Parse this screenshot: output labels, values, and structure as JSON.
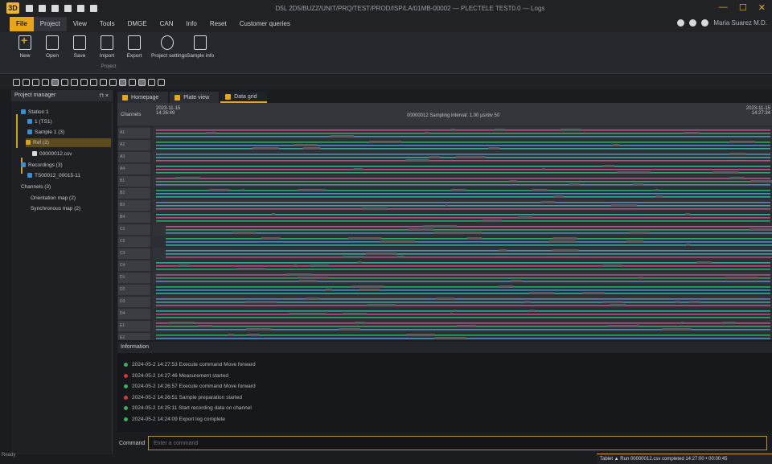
{
  "window": {
    "title": "D5L 2D5/BUZZ/UNIT/PRQ/TEST/PROD/ISP/LA/01MB-00002 — PLECTELE TEST0.0 — Logs",
    "app_logo": "3D",
    "controls": [
      "—",
      "☐",
      "✕"
    ]
  },
  "menu": {
    "items": [
      "File",
      "Project",
      "View",
      "Tools",
      "DMGE",
      "CAN",
      "Info",
      "Reset",
      "Customer queries"
    ],
    "user": "Maria Suarez M.D."
  },
  "ribbon": {
    "buttons": [
      {
        "id": "new",
        "label": "New"
      },
      {
        "id": "open",
        "label": "Open"
      },
      {
        "id": "save",
        "label": "Save"
      },
      {
        "id": "import",
        "label": "Import"
      },
      {
        "id": "export",
        "label": "Export"
      },
      {
        "id": "project-settings",
        "label": "Project settings"
      },
      {
        "id": "sample-info",
        "label": "Sample info"
      }
    ],
    "group_label": "Project"
  },
  "explorer": {
    "title": "Project manager",
    "nodes": [
      {
        "label": "Station 1",
        "level": 0
      },
      {
        "label": "1 (TS1)",
        "level": 1
      },
      {
        "label": "Sample 1 (3)",
        "level": 1
      },
      {
        "label": "Ref (2)",
        "level": 1,
        "selected": true
      },
      {
        "label": "00000012.csv",
        "level": 2
      },
      {
        "label": "Recordings (3)",
        "level": 0
      },
      {
        "label": "TS00012_00015-11",
        "level": 1
      },
      {
        "label": "Channels (3)",
        "level": 0
      },
      {
        "label": "Orientation map (2)",
        "level": 1
      },
      {
        "label": "Synchronous map (2)",
        "level": 1
      }
    ]
  },
  "tabs": [
    {
      "label": "Homepage",
      "active": false
    },
    {
      "label": "Plate view",
      "active": false
    },
    {
      "label": "Data grid",
      "active": true
    }
  ],
  "timeline": {
    "corner_label": "Channels",
    "start_label": "2023-11-15 14:26:49",
    "end_label": "2023-11-15 14:27:34",
    "center_label": "00000012 Sampling interval: 1.00 µs/div 50",
    "rows": [
      "A1",
      "A2",
      "A3",
      "A4",
      "B1",
      "B2",
      "B3",
      "B4",
      "C1",
      "C2",
      "C3",
      "C4",
      "D1",
      "D2",
      "D3",
      "D4",
      "E1",
      "E2"
    ],
    "colors": {
      "pink": "#c14a8a",
      "green": "#2ea86a",
      "blue": "#4a8fc2",
      "teal": "#3aa8a0"
    }
  },
  "info": {
    "title": "Information",
    "logs": [
      {
        "status": "ok",
        "text": "2024-05-2 14:27:53 Execute command Move forward"
      },
      {
        "status": "err",
        "text": "2024-05-2 14:27:46 Measurement started"
      },
      {
        "status": "ok",
        "text": "2024-05-2 14:26:57 Execute command Move forward"
      },
      {
        "status": "err",
        "text": "2024-05-2 14:26:51 Sample preparation started"
      },
      {
        "status": "ok",
        "text": "2024-05-2 14:25:11 Start recording data on channel"
      },
      {
        "status": "ok",
        "text": "2024-05-2 14:24:09 Export log complete"
      }
    ]
  },
  "command": {
    "label": "Command",
    "placeholder": "Enter a command"
  },
  "status": {
    "left": "Ready",
    "right": "Tablet ▲  Run 00000012.csv completed 14:27:00 • 00:00:45"
  }
}
